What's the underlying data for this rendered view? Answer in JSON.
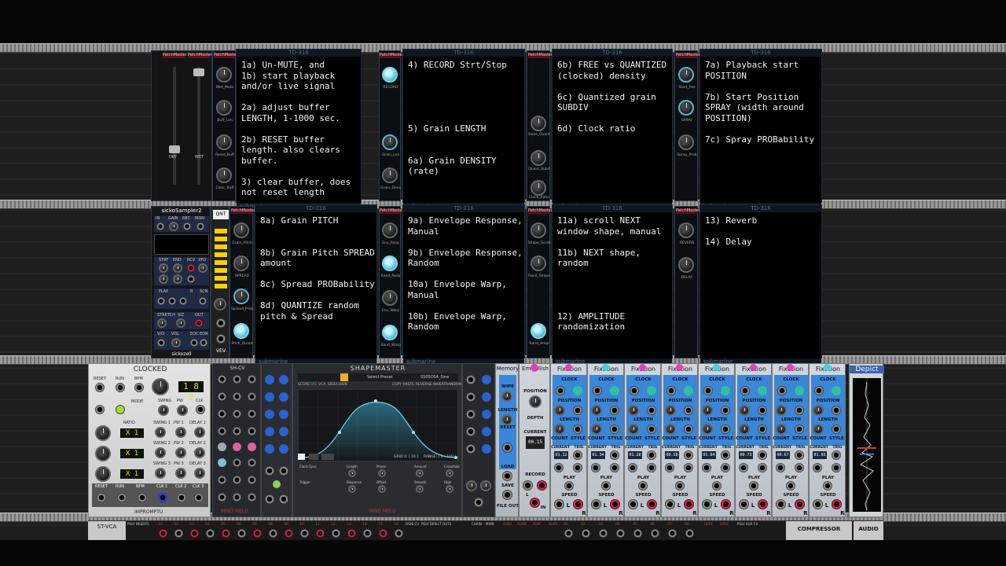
{
  "textboxes": {
    "t1": "1a) Un-MUTE, and\n1b) start playback\nand/or live signal\n\n2a) adjust buffer\nLENGTH, 1-1000 sec.\n\n2b) RESET buffer\nlength. also clears\nbuffer.\n\n3) clear buffer, does\nnot reset length",
    "t2": "4) RECORD Strt/Stop\n\n\n\n\n\n5) Grain LENGTH\n\n\n6a) Grain DENSITY\n(rate)",
    "t3": "6b) FREE vs QUANTIZED\n(clocked) density\n\n6c) Quantized grain\nSUBDIV\n\n6d) Clock ratio",
    "t4": "7a) Playback start\nPOSITION\n\n7b) Start Position\nSPRAY (width around\nPOSITION)\n\n7c) Spray PROBability",
    "t5": "8a) Grain PITCH\n\n\n8b) Grain Pitch SPREAD\namount\n\n8c) Spread PROBability\n\n8d) QUANTIZE random\npitch & Spread",
    "t6": "9a) Envelope Response,\nManual\n\n9b) Envelope Response,\nRandom\n\n10a) Envelope Warp,\nManual\n\n10b) Envelope Warp,\nRandom",
    "t7": "11a) scroll NEXT\nwindow shape, manual\n\n11b) NEXT shape,\nrandom\n\n\n\n\n12) AMPLITUDE\nrandomization",
    "t8": "13) Reverb\n\n14) Delay"
  },
  "td_title": "TD-316",
  "td_footer": "submarine",
  "patchmaster_label": "PatchMaster",
  "knobs_row1": {
    "col1": [
      "Wet_Mute",
      "Buff_Len",
      "Reset_Buff",
      "Clear_Buff"
    ],
    "col2": [
      "RECORD",
      "Grain_Len",
      "Grain_Dens"
    ],
    "col3": [
      "Dens_Quant",
      "Quant_Subd",
      "Clock_Ratio"
    ],
    "col4": [
      "Start_Pos",
      "SPRAY",
      "Spray_Prob"
    ]
  },
  "knobs_row2": {
    "col1": [
      "Grain_Pitch",
      "SPREAD",
      "Spread_Prob",
      "Pitch_Quant"
    ],
    "col2": [
      "Env_Resp",
      "Rand_Resp",
      "Env_Warp",
      "Rand_Warp"
    ],
    "col3": [
      "Shape_Scroll",
      "Rand_Shape",
      "Rand_Ampl"
    ],
    "col4": [
      "REVERB",
      "DELAY"
    ]
  },
  "fader_labels": [
    "DRY",
    "WET"
  ],
  "sampler": {
    "title": "sickoSampler2",
    "bottom": "sickozell",
    "labels": [
      "IN",
      "GAIN",
      "REC",
      "MON",
      "STRT",
      "END",
      "RCV",
      "XFD",
      "PLAY",
      "R",
      "SCN",
      "STRETCH",
      "SIZ",
      "OUT",
      "VOL",
      "V/O",
      "EOC",
      "EOR"
    ]
  },
  "qnt_label": "QNT",
  "vev_label": "VEV",
  "clocked": {
    "title": "CLOCKED",
    "bpm": "1 8 2",
    "ratios": [
      "X 1",
      "X 1",
      "X 1"
    ],
    "labels": [
      "RESET",
      "RUN",
      "BPM",
      "SWING",
      "PW",
      "CLK",
      "RATIO",
      "SWING 1",
      "PW 1",
      "DELAY 1",
      "SWING 2",
      "PW 2",
      "DELAY 2",
      "SWING 3",
      "PW 3",
      "DELAY 3",
      "RESET",
      "RUN",
      "BPM",
      "CLK 1",
      "CLK 2",
      "CLK 3"
    ],
    "mode": "MODE",
    "brand": "IMPROMPTU"
  },
  "shcv_title": "SH-CV",
  "shapemaster": {
    "title": "SHAPEMASTER",
    "preset": "Select Preset",
    "shape": "SS0SOS4_Sine",
    "tabs": [
      "SCOPE",
      "OFF",
      "VCA",
      "SIDECHAIN"
    ],
    "actions": [
      "COPY",
      "PASTE",
      "REVERSE",
      "INVERT",
      "RANDOM"
    ],
    "grid": "GRID X: [ 16 ]",
    "range": "RANGE: [ 0 - 10V ]",
    "params": [
      "Clock Sync",
      "Length",
      "Phase",
      "Amount",
      "Crossfade",
      "Trigger",
      "Response",
      "Offset",
      "Audio",
      "Smooth",
      "High"
    ]
  },
  "fixations": {
    "title": "Fixation",
    "labels": [
      "CLOCK",
      "POSITION",
      "LENGTH",
      "COUNT",
      "STYLE",
      "CURRENT",
      "TRIG",
      "PLAY",
      "SPEED",
      "L",
      "R"
    ],
    "readouts": [
      "01.12",
      "01.34",
      "01.28",
      "00.58",
      "01.84",
      "00.73",
      "00.67",
      "01.05"
    ]
  },
  "memory": {
    "title": "Memory",
    "labels": [
      "WIPE",
      "LENGTH",
      "RESET",
      "LOAD",
      "SAVE",
      "FILE",
      "OUT"
    ]
  },
  "embellish": {
    "title": "Embellish",
    "labels": [
      "POSITION",
      "DEPTH",
      "CURRENT",
      "RECORD",
      "L",
      "IN"
    ],
    "readout": "00.15"
  },
  "depict_title": "Depict",
  "bottom_strip": {
    "st_vca": "ST-VCA",
    "poly_inserts": "POLY INSERTS",
    "channels": [
      "-01-",
      "-02-",
      "-03-",
      "-04-",
      "-05-",
      "-06-",
      "-07-",
      "-08-",
      "-09-",
      "-10-",
      "-11-",
      "-12-",
      "-13-",
      "-14-",
      "-15-",
      "-16-"
    ],
    "fade_cv": "FADE CV",
    "poly_direct_outs": "POLY DIRECT OUTS",
    "chain": "CHAIN",
    "main": "MAIN",
    "aux": [
      "AUXA",
      "AUXB",
      "AUXC",
      "AUXD"
    ],
    "channels2": [
      "-01-",
      "-02-",
      "-03-",
      "-04-",
      "-05-",
      "-06-",
      "-07-",
      "-08-"
    ],
    "grp": [
      "GRP1",
      "GRP2"
    ],
    "poly_aux_cv": "POLY AUX CV",
    "compressor": "COMPRESSOR",
    "audio": "AUDIO"
  },
  "mindmeld": "MIND MELD"
}
